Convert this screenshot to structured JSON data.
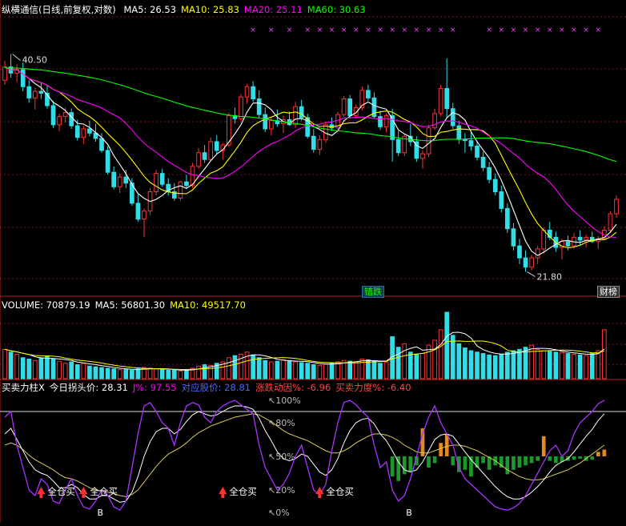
{
  "title": "纵横通信(日线,前复权,对数)",
  "price_panel": {
    "ma_labels": [
      {
        "label": "MA5: 26.53",
        "color": "#ffffff"
      },
      {
        "label": "MA10: 25.83",
        "color": "#ffff00"
      },
      {
        "label": "MA20: 25.11",
        "color": "#ff00ff"
      },
      {
        "label": "MA60: 30.63",
        "color": "#00ff00"
      }
    ],
    "high_label": "40.50",
    "low_label": "21.80",
    "tags": {
      "cuodie": "错跌",
      "caibang": "财榜"
    }
  },
  "volume_panel": {
    "labels": [
      {
        "label": "VOLUME: 70879.19",
        "color": "#ffffff"
      },
      {
        "label": "MA5: 56801.30",
        "color": "#ffffff"
      },
      {
        "label": "MA10: 49517.70",
        "color": "#ffff00"
      }
    ]
  },
  "indicator_panel": {
    "labels": [
      {
        "label": "买卖力柱X",
        "color": "#ffffff"
      },
      {
        "label": "今日拐头价: 28.31",
        "color": "#ffffff"
      },
      {
        "label": "J%: 97.55",
        "color": "#ff00ff"
      },
      {
        "label": "对应股价: 28.81",
        "color": "#4466ff"
      },
      {
        "label": "涨跌动因%: -6.96",
        "color": "#ff4444"
      },
      {
        "label": "买卖力度%: -6.40",
        "color": "#ff4444"
      }
    ],
    "levels": [
      "100%",
      "80%",
      "50%",
      "20%",
      "0%"
    ],
    "buy_signal_text": "全仓买",
    "b_marker": "B"
  },
  "chart_data": {
    "type": "candlestick",
    "price": {
      "scale": "log",
      "ylim": [
        20.5,
        46
      ],
      "candles": [
        [
          38.0,
          40.2,
          37.5,
          39.5
        ],
        [
          39.5,
          41.0,
          38.3,
          38.8
        ],
        [
          38.8,
          39.8,
          37.8,
          39.2
        ],
        [
          39.2,
          40.0,
          36.8,
          37.3
        ],
        [
          37.3,
          38.0,
          35.6,
          36.1
        ],
        [
          36.1,
          37.2,
          34.9,
          36.8
        ],
        [
          36.8,
          37.8,
          36.0,
          36.6
        ],
        [
          36.6,
          37.4,
          35.0,
          35.3
        ],
        [
          35.3,
          35.8,
          33.1,
          33.4
        ],
        [
          33.4,
          34.5,
          32.8,
          34.2
        ],
        [
          34.2,
          35.1,
          33.6,
          34.6
        ],
        [
          34.6,
          35.0,
          33.0,
          33.3
        ],
        [
          33.3,
          33.9,
          31.9,
          32.2
        ],
        [
          32.2,
          33.3,
          31.6,
          33.0
        ],
        [
          33.0,
          33.8,
          32.3,
          32.6
        ],
        [
          32.6,
          33.5,
          31.8,
          32.1
        ],
        [
          32.1,
          32.6,
          30.8,
          31.0
        ],
        [
          31.0,
          31.4,
          28.9,
          29.1
        ],
        [
          29.1,
          29.6,
          27.7,
          27.9
        ],
        [
          27.9,
          29.0,
          27.4,
          28.7
        ],
        [
          28.7,
          29.3,
          27.8,
          28.2
        ],
        [
          28.2,
          28.6,
          26.4,
          26.6
        ],
        [
          26.6,
          27.3,
          25.2,
          25.4
        ],
        [
          25.4,
          26.2,
          24.1,
          26.0
        ],
        [
          26.0,
          27.8,
          25.7,
          27.5
        ],
        [
          27.5,
          29.3,
          27.2,
          29.0
        ],
        [
          29.0,
          29.4,
          27.9,
          28.1
        ],
        [
          28.1,
          28.6,
          27.2,
          27.5
        ],
        [
          27.5,
          28.2,
          26.8,
          27.0
        ],
        [
          27.0,
          28.4,
          26.8,
          28.3
        ],
        [
          28.3,
          28.9,
          27.7,
          28.0
        ],
        [
          28.0,
          29.9,
          27.8,
          29.6
        ],
        [
          29.6,
          31.2,
          29.4,
          30.8
        ],
        [
          30.8,
          31.5,
          29.9,
          30.2
        ],
        [
          30.2,
          32.2,
          30.1,
          31.8
        ],
        [
          31.8,
          32.4,
          30.7,
          31.0
        ],
        [
          31.0,
          31.7,
          30.2,
          31.5
        ],
        [
          31.5,
          34.6,
          31.3,
          34.3
        ],
        [
          34.3,
          35.1,
          33.5,
          34.0
        ],
        [
          34.0,
          36.5,
          33.8,
          36.2
        ],
        [
          36.2,
          37.6,
          35.5,
          37.3
        ],
        [
          37.3,
          37.9,
          35.7,
          36.0
        ],
        [
          36.0,
          36.9,
          34.1,
          34.4
        ],
        [
          34.4,
          35.1,
          32.7,
          33.0
        ],
        [
          33.0,
          34.1,
          32.4,
          33.8
        ],
        [
          33.8,
          34.9,
          33.2,
          33.5
        ],
        [
          33.5,
          34.3,
          32.6,
          33.9
        ],
        [
          33.9,
          34.7,
          33.3,
          33.4
        ],
        [
          33.4,
          35.7,
          33.1,
          35.2
        ],
        [
          35.2,
          35.9,
          33.8,
          34.1
        ],
        [
          34.1,
          34.5,
          32.1,
          32.3
        ],
        [
          32.3,
          33.0,
          30.8,
          31.1
        ],
        [
          31.1,
          32.4,
          30.6,
          32.0
        ],
        [
          32.0,
          33.6,
          31.7,
          33.4
        ],
        [
          33.4,
          34.1,
          32.8,
          33.1
        ],
        [
          33.1,
          34.7,
          32.9,
          34.4
        ],
        [
          34.4,
          36.3,
          34.2,
          36.0
        ],
        [
          36.0,
          36.4,
          34.1,
          34.3
        ],
        [
          34.3,
          35.4,
          34.0,
          35.1
        ],
        [
          35.1,
          37.3,
          34.8,
          36.9
        ],
        [
          36.9,
          37.5,
          35.8,
          36.1
        ],
        [
          36.1,
          36.7,
          34.0,
          34.2
        ],
        [
          34.2,
          34.8,
          32.9,
          33.2
        ],
        [
          33.2,
          34.5,
          32.7,
          34.3
        ],
        [
          34.3,
          35.0,
          30.0,
          32.0
        ],
        [
          32.0,
          32.8,
          30.5,
          30.8
        ],
        [
          30.8,
          32.5,
          30.5,
          32.3
        ],
        [
          32.3,
          33.5,
          31.4,
          31.8
        ],
        [
          31.8,
          32.3,
          30.0,
          30.3
        ],
        [
          30.3,
          31.0,
          29.4,
          30.7
        ],
        [
          30.7,
          33.4,
          30.4,
          33.1
        ],
        [
          33.1,
          35.0,
          32.9,
          34.5
        ],
        [
          34.5,
          37.5,
          34.2,
          37.1
        ],
        [
          37.1,
          40.5,
          34.0,
          35.0
        ],
        [
          35.0,
          35.6,
          33.0,
          33.3
        ],
        [
          33.3,
          33.8,
          31.6,
          32.0
        ],
        [
          32.0,
          32.6,
          30.8,
          31.9
        ],
        [
          31.9,
          32.8,
          31.0,
          31.4
        ],
        [
          31.4,
          31.9,
          30.1,
          30.4
        ],
        [
          30.4,
          30.9,
          29.2,
          29.5
        ],
        [
          29.5,
          30.0,
          28.2,
          28.5
        ],
        [
          28.5,
          29.0,
          27.2,
          27.5
        ],
        [
          27.5,
          28.0,
          25.9,
          26.2
        ],
        [
          26.2,
          26.6,
          24.4,
          24.7
        ],
        [
          24.7,
          25.1,
          23.2,
          23.5
        ],
        [
          23.5,
          24.0,
          22.3,
          22.7
        ],
        [
          22.7,
          23.2,
          21.8,
          22.1
        ],
        [
          22.1,
          22.9,
          21.9,
          22.7
        ],
        [
          22.7,
          23.5,
          22.3,
          23.3
        ],
        [
          23.3,
          24.8,
          23.0,
          24.6
        ],
        [
          24.6,
          25.2,
          23.9,
          24.1
        ],
        [
          24.1,
          24.5,
          23.1,
          23.4
        ],
        [
          23.4,
          24.0,
          22.6,
          23.8
        ],
        [
          23.8,
          24.2,
          23.2,
          23.5
        ],
        [
          23.5,
          24.4,
          23.3,
          24.1
        ],
        [
          24.1,
          24.6,
          23.6,
          23.9
        ],
        [
          23.9,
          24.3,
          23.4,
          24.1
        ],
        [
          24.1,
          24.5,
          23.7,
          23.8
        ],
        [
          23.8,
          24.2,
          23.3,
          24.0
        ],
        [
          24.0,
          24.9,
          23.9,
          24.6
        ],
        [
          24.6,
          26.0,
          24.4,
          25.8
        ],
        [
          25.8,
          27.2,
          25.5,
          26.9
        ]
      ],
      "ma": [
        {
          "name": "MA5",
          "color": "#ffffff"
        },
        {
          "name": "MA10",
          "color": "#ffff00"
        },
        {
          "name": "MA20",
          "color": "#ff00ff"
        },
        {
          "name": "MA60",
          "color": "#00ff00"
        }
      ]
    },
    "volume": {
      "values": [
        42,
        38,
        35,
        30,
        28,
        26,
        30,
        32,
        28,
        25,
        22,
        24,
        20,
        22,
        18,
        17,
        16,
        15,
        14,
        13,
        13,
        12,
        14,
        16,
        15,
        14,
        13,
        12,
        12,
        11,
        13,
        15,
        18,
        20,
        19,
        22,
        24,
        30,
        33,
        35,
        38,
        34,
        30,
        26,
        24,
        25,
        27,
        26,
        24,
        23,
        22,
        20,
        19,
        21,
        22,
        24,
        26,
        25,
        24,
        28,
        27,
        25,
        22,
        24,
        60,
        45,
        50,
        38,
        35,
        36,
        48,
        55,
        70,
        95,
        62,
        50,
        44,
        40,
        38,
        36,
        34,
        33,
        35,
        38,
        40,
        42,
        45,
        48,
        42,
        40,
        39,
        38,
        37,
        36,
        35,
        34,
        33,
        36,
        40,
        70
      ],
      "ma": [
        {
          "name": "MA5",
          "color": "#ffffff"
        },
        {
          "name": "MA10",
          "color": "#ffff00"
        }
      ]
    },
    "indicator": {
      "j_line": [
        85,
        90,
        60,
        40,
        20,
        15,
        30,
        25,
        10,
        8,
        20,
        30,
        15,
        5,
        3,
        10,
        20,
        15,
        5,
        2,
        10,
        40,
        70,
        95,
        98,
        90,
        80,
        75,
        60,
        80,
        95,
        98,
        96,
        85,
        80,
        90,
        95,
        98,
        100,
        96,
        92,
        88,
        60,
        40,
        30,
        20,
        25,
        35,
        50,
        60,
        40,
        20,
        15,
        25,
        55,
        80,
        98,
        100,
        96,
        90,
        85,
        60,
        40,
        45,
        20,
        10,
        15,
        30,
        50,
        70,
        85,
        95,
        80,
        70,
        60,
        40,
        30,
        25,
        20,
        15,
        10,
        5,
        3,
        2,
        4,
        8,
        15,
        25,
        35,
        45,
        55,
        60,
        50,
        55,
        70,
        80,
        85,
        90,
        97,
        100
      ],
      "white_line": [
        70,
        75,
        65,
        55,
        45,
        38,
        35,
        33,
        28,
        22,
        22,
        25,
        22,
        16,
        12,
        12,
        15,
        15,
        12,
        9,
        10,
        18,
        32,
        50,
        63,
        72,
        75,
        75,
        70,
        74,
        81,
        87,
        90,
        88,
        86,
        87,
        90,
        93,
        95,
        95,
        94,
        92,
        84,
        73,
        64,
        54,
        48,
        46,
        48,
        52,
        50,
        43,
        36,
        33,
        38,
        48,
        62,
        73,
        80,
        83,
        84,
        79,
        70,
        64,
        55,
        45,
        38,
        36,
        38,
        45,
        55,
        65,
        69,
        70,
        68,
        61,
        54,
        47,
        41,
        35,
        29,
        23,
        18,
        14,
        12,
        12,
        14,
        18,
        23,
        29,
        36,
        42,
        45,
        48,
        54,
        61,
        68,
        74,
        82,
        88
      ],
      "yellow_line": [
        60,
        62,
        60,
        56,
        51,
        47,
        44,
        41,
        38,
        34,
        31,
        30,
        28,
        25,
        22,
        20,
        19,
        18,
        17,
        15,
        14,
        16,
        20,
        27,
        34,
        41,
        47,
        52,
        55,
        58,
        62,
        67,
        71,
        74,
        77,
        79,
        81,
        83,
        85,
        86,
        87,
        88,
        87,
        84,
        81,
        77,
        73,
        70,
        68,
        66,
        64,
        61,
        58,
        55,
        53,
        53,
        55,
        58,
        62,
        65,
        68,
        70,
        70,
        69,
        67,
        64,
        60,
        57,
        54,
        53,
        53,
        55,
        57,
        59,
        60,
        60,
        59,
        57,
        55,
        52,
        49,
        46,
        42,
        38,
        35,
        32,
        30,
        29,
        29,
        30,
        32,
        34,
        36,
        38,
        41,
        44,
        48,
        52,
        56,
        60
      ],
      "force_bars": [
        0,
        0,
        0,
        0,
        0,
        0,
        0,
        0,
        0,
        0,
        0,
        0,
        0,
        0,
        0,
        0,
        0,
        0,
        0,
        0,
        0,
        0,
        0,
        0,
        0,
        0,
        0,
        0,
        0,
        0,
        0,
        0,
        0,
        0,
        0,
        0,
        0,
        0,
        0,
        0,
        0,
        0,
        0,
        0,
        0,
        0,
        0,
        0,
        0,
        0,
        0,
        0,
        0,
        0,
        0,
        0,
        0,
        0,
        0,
        0,
        0,
        0,
        0,
        0,
        -18,
        -22,
        -16,
        -14,
        -8,
        25,
        -10,
        -6,
        12,
        20,
        -8,
        -14,
        -12,
        -18,
        -10,
        -6,
        -12,
        -8,
        -10,
        -16,
        -12,
        -10,
        -8,
        -6,
        -4,
        18,
        -4,
        -6,
        -5,
        -4,
        -3,
        -2,
        -4,
        -3,
        4,
        6
      ],
      "reference_line": 90,
      "levels": [
        100,
        80,
        50,
        20,
        0
      ],
      "buy_signals": [
        6,
        13,
        36,
        52
      ],
      "b_markers": [
        15,
        66
      ]
    }
  }
}
